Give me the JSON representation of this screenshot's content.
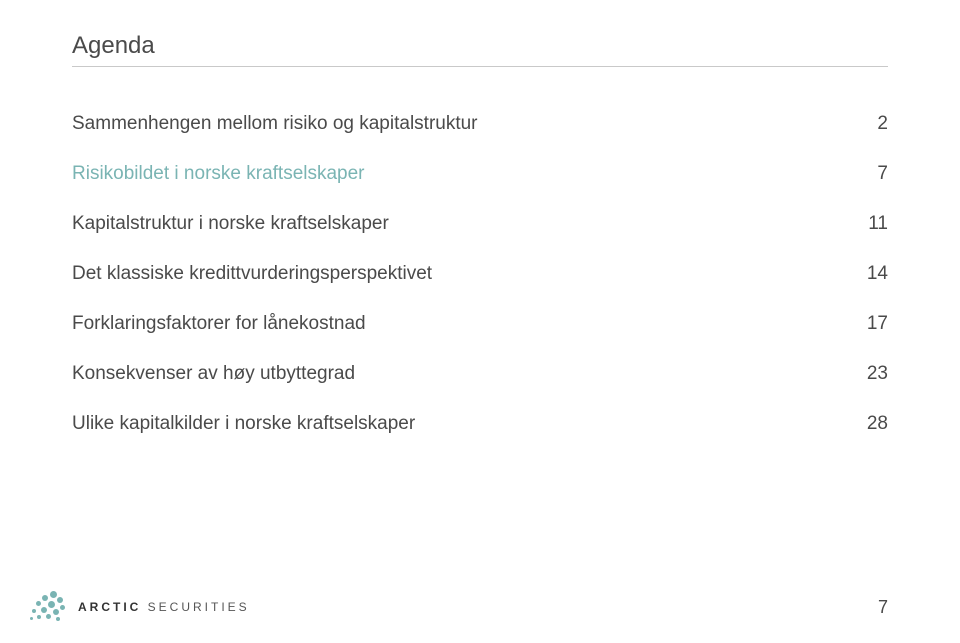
{
  "title": "Agenda",
  "agenda": [
    {
      "label": "Sammenhengen mellom risiko og kapitalstruktur",
      "page": "2",
      "highlight": false
    },
    {
      "label": "Risikobildet i norske kraftselskaper",
      "page": "7",
      "highlight": true
    },
    {
      "label": "Kapitalstruktur i norske kraftselskaper",
      "page": "11",
      "highlight": false
    },
    {
      "label": "Det klassiske kredittvurderingsperspektivet",
      "page": "14",
      "highlight": false
    },
    {
      "label": "Forklaringsfaktorer for lånekostnad",
      "page": "17",
      "highlight": false
    },
    {
      "label": "Konsekvenser av høy utbyttegrad",
      "page": "23",
      "highlight": false
    },
    {
      "label": "Ulike kapitalkilder i norske kraftselskaper",
      "page": "28",
      "highlight": false
    }
  ],
  "brand": {
    "bold": "ARCTIC",
    "rest": " SECURITIES"
  },
  "page_number": "7"
}
